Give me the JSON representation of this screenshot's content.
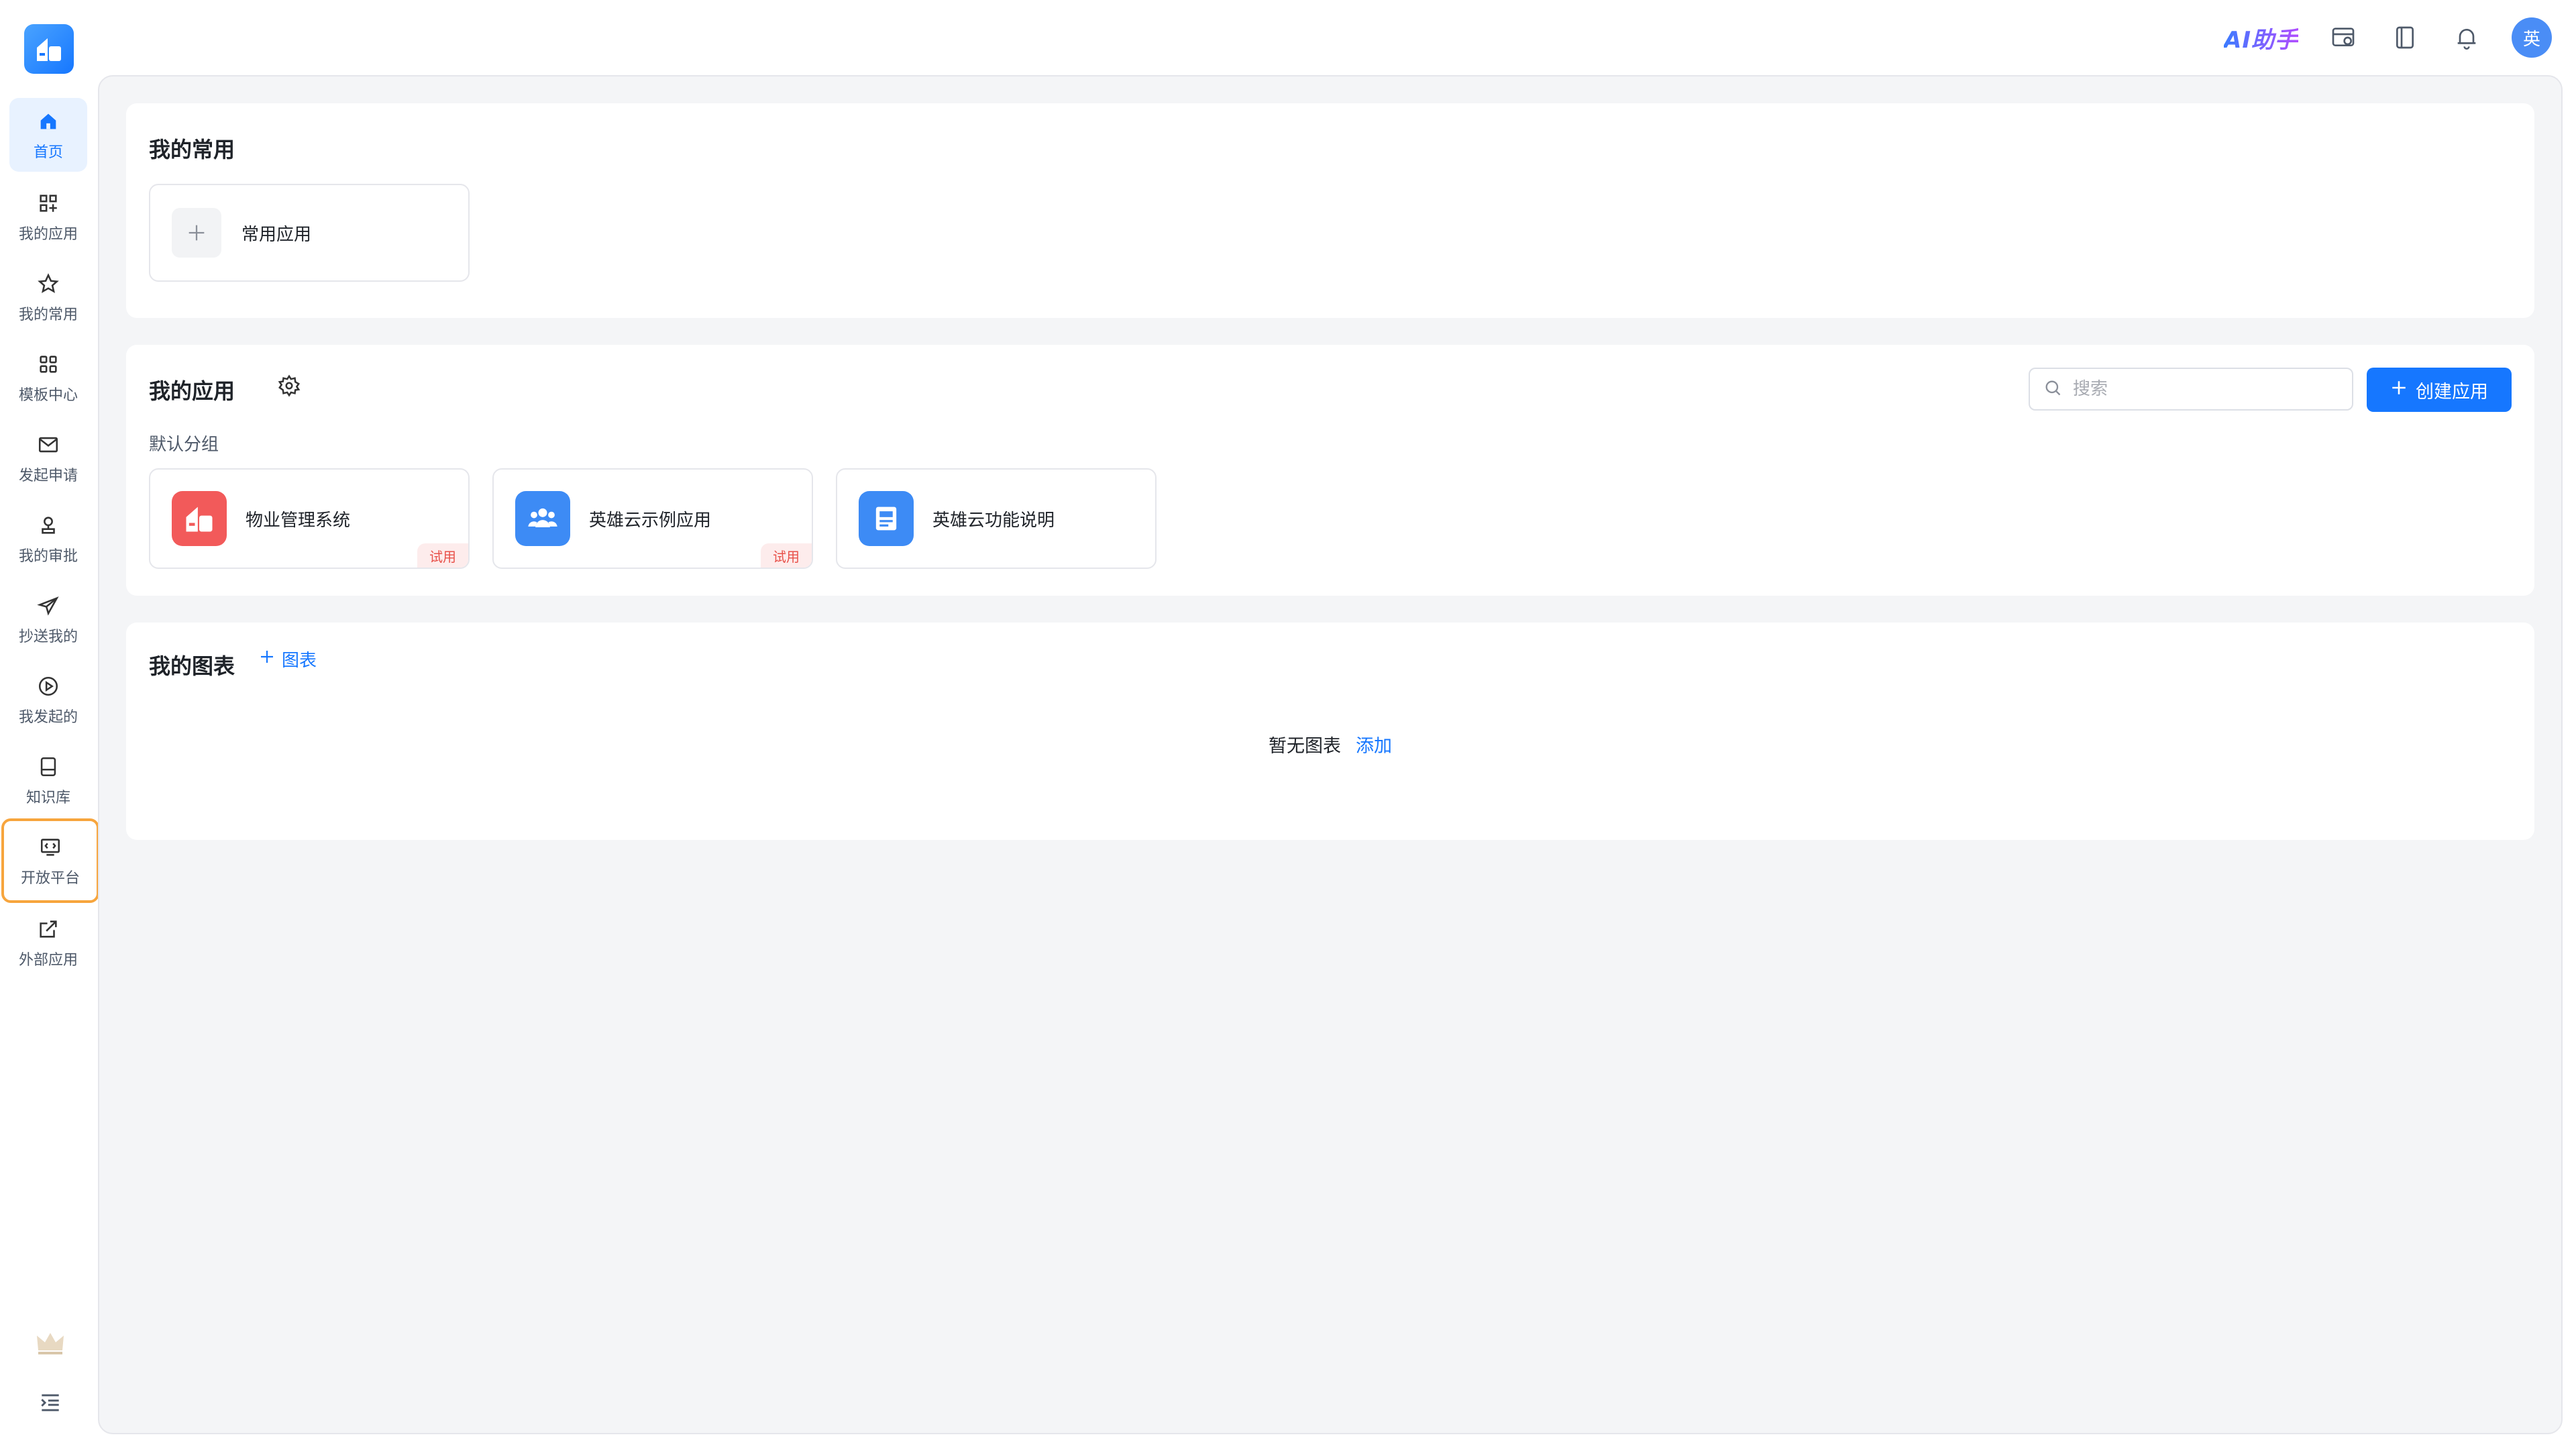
{
  "topbar": {
    "ai_assistant": "AI助手",
    "avatar_text": "英",
    "icons": [
      "calendar-icon",
      "book-icon",
      "bell-icon"
    ]
  },
  "sidebar": {
    "items": [
      {
        "label": "首页",
        "icon": "home-icon",
        "active": true
      },
      {
        "label": "我的应用",
        "icon": "apps-icon"
      },
      {
        "label": "我的常用",
        "icon": "star-icon"
      },
      {
        "label": "模板中心",
        "icon": "template-icon"
      },
      {
        "label": "发起申请",
        "icon": "mail-icon"
      },
      {
        "label": "我的审批",
        "icon": "approver-icon"
      },
      {
        "label": "抄送我的",
        "icon": "send-icon"
      },
      {
        "label": "我发起的",
        "icon": "play-circle-icon"
      },
      {
        "label": "知识库",
        "icon": "knowledge-book-icon"
      },
      {
        "label": "开放平台",
        "icon": "open-platform-icon",
        "highlighted": true
      },
      {
        "label": "外部应用",
        "icon": "external-link-icon"
      }
    ],
    "bottom_icons": [
      "crown-icon",
      "collapse-menu-icon"
    ]
  },
  "favorites": {
    "title": "我的常用",
    "tile_label": "常用应用"
  },
  "my_apps": {
    "title": "我的应用",
    "search_placeholder": "搜索",
    "create_label": "创建应用",
    "group_label": "默认分组",
    "apps": [
      {
        "name": "物业管理系统",
        "badge": "试用",
        "color": "#f25a5a"
      },
      {
        "name": "英雄云示例应用",
        "badge": "试用",
        "color": "#3d8bf5"
      },
      {
        "name": "英雄云功能说明",
        "badge": "",
        "color": "#3d8bf5"
      }
    ]
  },
  "my_charts": {
    "title": "我的图表",
    "add_label": "图表",
    "empty_text": "暂无图表",
    "empty_add": "添加"
  },
  "colors": {
    "accent": "#1677ff",
    "highlight": "#f7a53d",
    "trial": "#e8514a"
  }
}
